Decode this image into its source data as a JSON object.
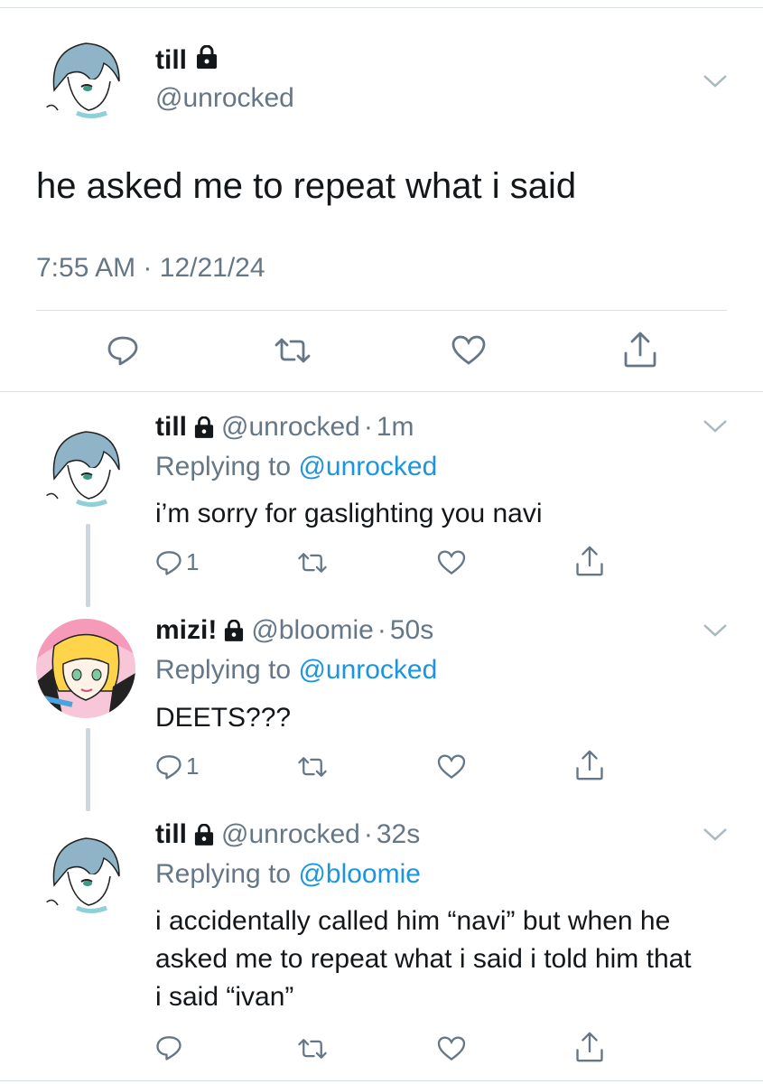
{
  "main_tweet": {
    "display_name": "till",
    "handle": "@unrocked",
    "text": "he asked me to repeat what i said",
    "time": "7:55 AM",
    "date": "12/21/24",
    "meta_sep": "·"
  },
  "replies": [
    {
      "display_name": "till",
      "handle": "@unrocked",
      "time_ago": "1m",
      "replying_prefix": "Replying to",
      "replying_to": "@unrocked",
      "text": "i’m sorry for gaslighting you navi",
      "reply_count": "1"
    },
    {
      "display_name": "mizi!",
      "handle": "@bloomie",
      "time_ago": "50s",
      "replying_prefix": "Replying to",
      "replying_to": "@unrocked",
      "text": "DEETS???",
      "reply_count": "1"
    },
    {
      "display_name": "till",
      "handle": "@unrocked",
      "time_ago": "32s",
      "replying_prefix": "Replying to",
      "replying_to": "@bloomie",
      "text": "i accidentally called him “navi” but when he asked me to repeat what i said i told him that i said “ivan”",
      "reply_count": ""
    }
  ],
  "dot": "·",
  "icons": {
    "lock": "lock-icon",
    "chevron": "chevron-down-icon",
    "reply": "reply-icon",
    "retweet": "retweet-icon",
    "like": "heart-icon",
    "share": "share-icon"
  },
  "colors": {
    "text": "#14171a",
    "muted": "#657786",
    "mention": "#1b95e0",
    "divider": "#d9dfe4",
    "thread_line": "#ccd6dd",
    "avatar_hair": "#8fb4c7",
    "avatar_mizi_bg": "#f7c7d9"
  }
}
